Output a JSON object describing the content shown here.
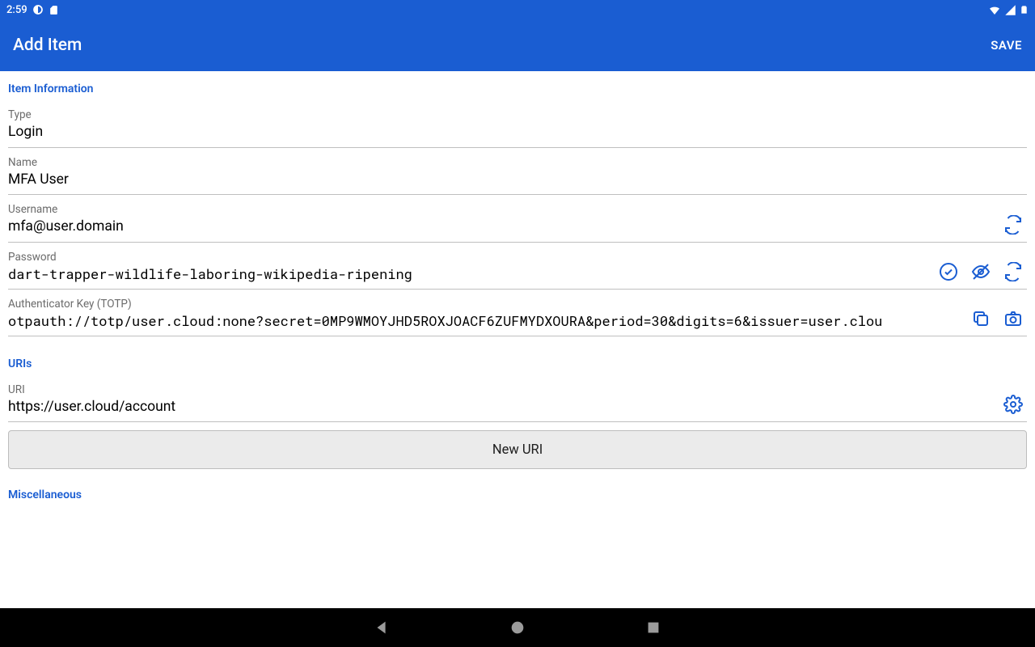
{
  "status": {
    "time": "2:59",
    "icons_left": [
      "circle-outline-icon",
      "sd-card-icon"
    ],
    "icons_right": [
      "wifi-icon",
      "signal-icon",
      "battery-icon"
    ]
  },
  "appbar": {
    "title": "Add Item",
    "save_label": "SAVE"
  },
  "sections": {
    "item_info_header": "Item Information",
    "uris_header": "URIs",
    "misc_header": "Miscellaneous"
  },
  "fields": {
    "type": {
      "label": "Type",
      "value": "Login"
    },
    "name": {
      "label": "Name",
      "value": "MFA User"
    },
    "username": {
      "label": "Username",
      "value": "mfa@user.domain"
    },
    "password": {
      "label": "Password",
      "value": "dart-trapper-wildlife-laboring-wikipedia-ripening"
    },
    "totp": {
      "label": "Authenticator Key (TOTP)",
      "value": "otpauth://totp/user.cloud:none?secret=0MP9WMOYJHD5ROXJOACF6ZUFMYDXOURA&period=30&digits=6&issuer=user.clou"
    },
    "uri": {
      "label": "URI",
      "value": "https://user.cloud/account"
    }
  },
  "buttons": {
    "new_uri": "New URI"
  }
}
